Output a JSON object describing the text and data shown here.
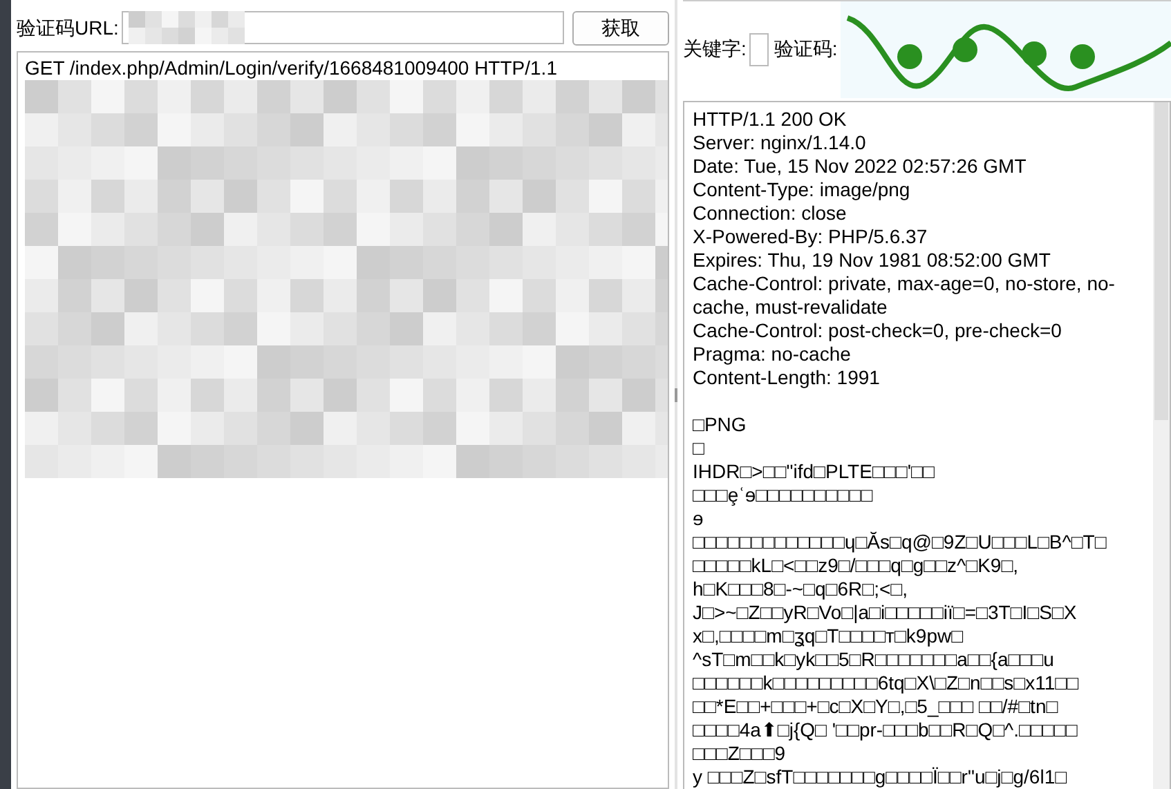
{
  "url_field": {
    "label": "验证码URL:"
  },
  "fetch_button": {
    "label": "获取"
  },
  "request": {
    "lines": [
      "GET /index.php/Admin/Login/verify/1668481009400 HTTP/1.1"
    ]
  },
  "keyword_field": {
    "label": "关键字:"
  },
  "captcha": {
    "label": "验证码:"
  },
  "response": {
    "headers": [
      "HTTP/1.1 200 OK",
      "Server: nginx/1.14.0",
      "Date: Tue, 15 Nov 2022 02:57:26 GMT",
      "Content-Type: image/png",
      "Connection: close",
      "X-Powered-By: PHP/5.6.37",
      "Expires: Thu, 19 Nov 1981 08:52:00 GMT",
      "Cache-Control: private, max-age=0, no-store, no-cache, must-revalidate",
      "Cache-Control: post-check=0, pre-check=0",
      "Pragma: no-cache",
      "Content-Length: 1991"
    ],
    "body": [
      "□PNG",
      "□",
      "IHDR□>□□\"ifd□PLTE□□□'□□",
      "□□□ȩʿɘ□□□□□□□□□□",
      "ɘ",
      "□□□□□□□□□□□□□ɥ□Ăs□q@□9Z□U□□□L□B^□T□",
      "□□□□□kL□<□□z9□/□□□q□g□□z^□K9□,",
      "h□K□□□8□-~□q□6R□;<□,",
      "J□>~□Z□□yR□Vo□|a□i□□□□□iï□=□3T□I□S□X",
      "x□,□□□□m□ʓq□T□□□□т□k9pw□",
      "^sT□m□□k□yk□□5□R□□□□□□□a□□{a□□□u",
      "□□□□□□k□□□□□□□□□6tq□X\\□Z□n□□s□x11□□",
      "□□*E□□+□□□+□c□X□Y□,□5_□□□ □□/#□tn□",
      "□□□□4a⬆□j{Q□ '□□pr-□□□b□□R□Q□^.□□□□□",
      "□□□Z□□□9",
      "y □□□Z□sfT□□□□□□□g□□□□Ï□□r\"u□j□g/6l1□"
    ]
  }
}
